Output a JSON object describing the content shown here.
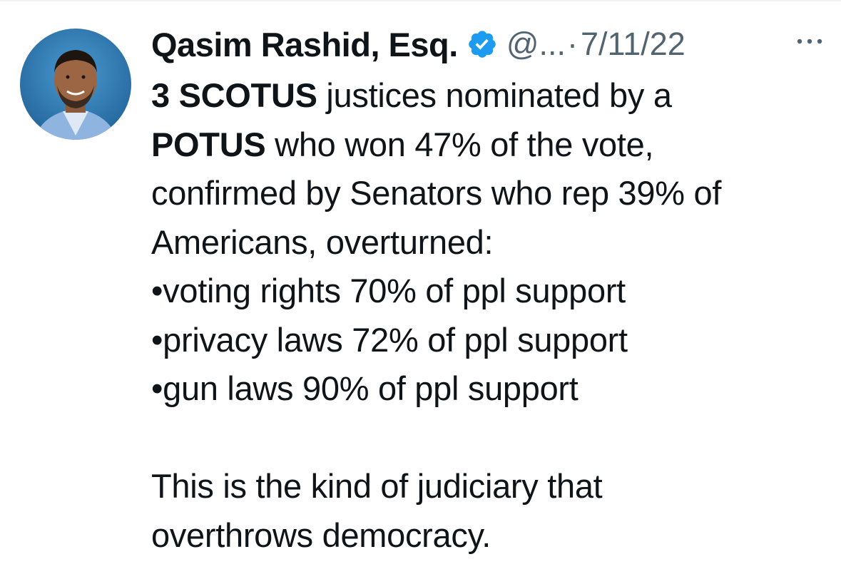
{
  "tweet": {
    "author": {
      "display_name": "Qasim Rashid, Esq.",
      "handle": "@...",
      "verified_icon": "verified-badge-icon",
      "avatar_icon": "avatar"
    },
    "separator": "·",
    "date": "7/11/22",
    "more_icon": "more-options-icon",
    "body": {
      "line1_bold": "3 SCOTUS",
      "line1_rest": " justices nominated by a",
      "line2_bold": "POTUS",
      "line2_rest": " who won 47% of the vote,",
      "line3": "confirmed by Senators who rep 39% of",
      "line4": "Americans, overturned:",
      "bullets": [
        "•voting rights 70% of ppl support",
        "•privacy laws 72% of ppl support",
        "•gun laws 90% of ppl support"
      ],
      "closing_line1": "This is the kind of judiciary that",
      "closing_line2": "overthrows democracy."
    }
  },
  "colors": {
    "text": "#0f1419",
    "secondary": "#536471",
    "verified_blue": "#1d9bf0"
  }
}
